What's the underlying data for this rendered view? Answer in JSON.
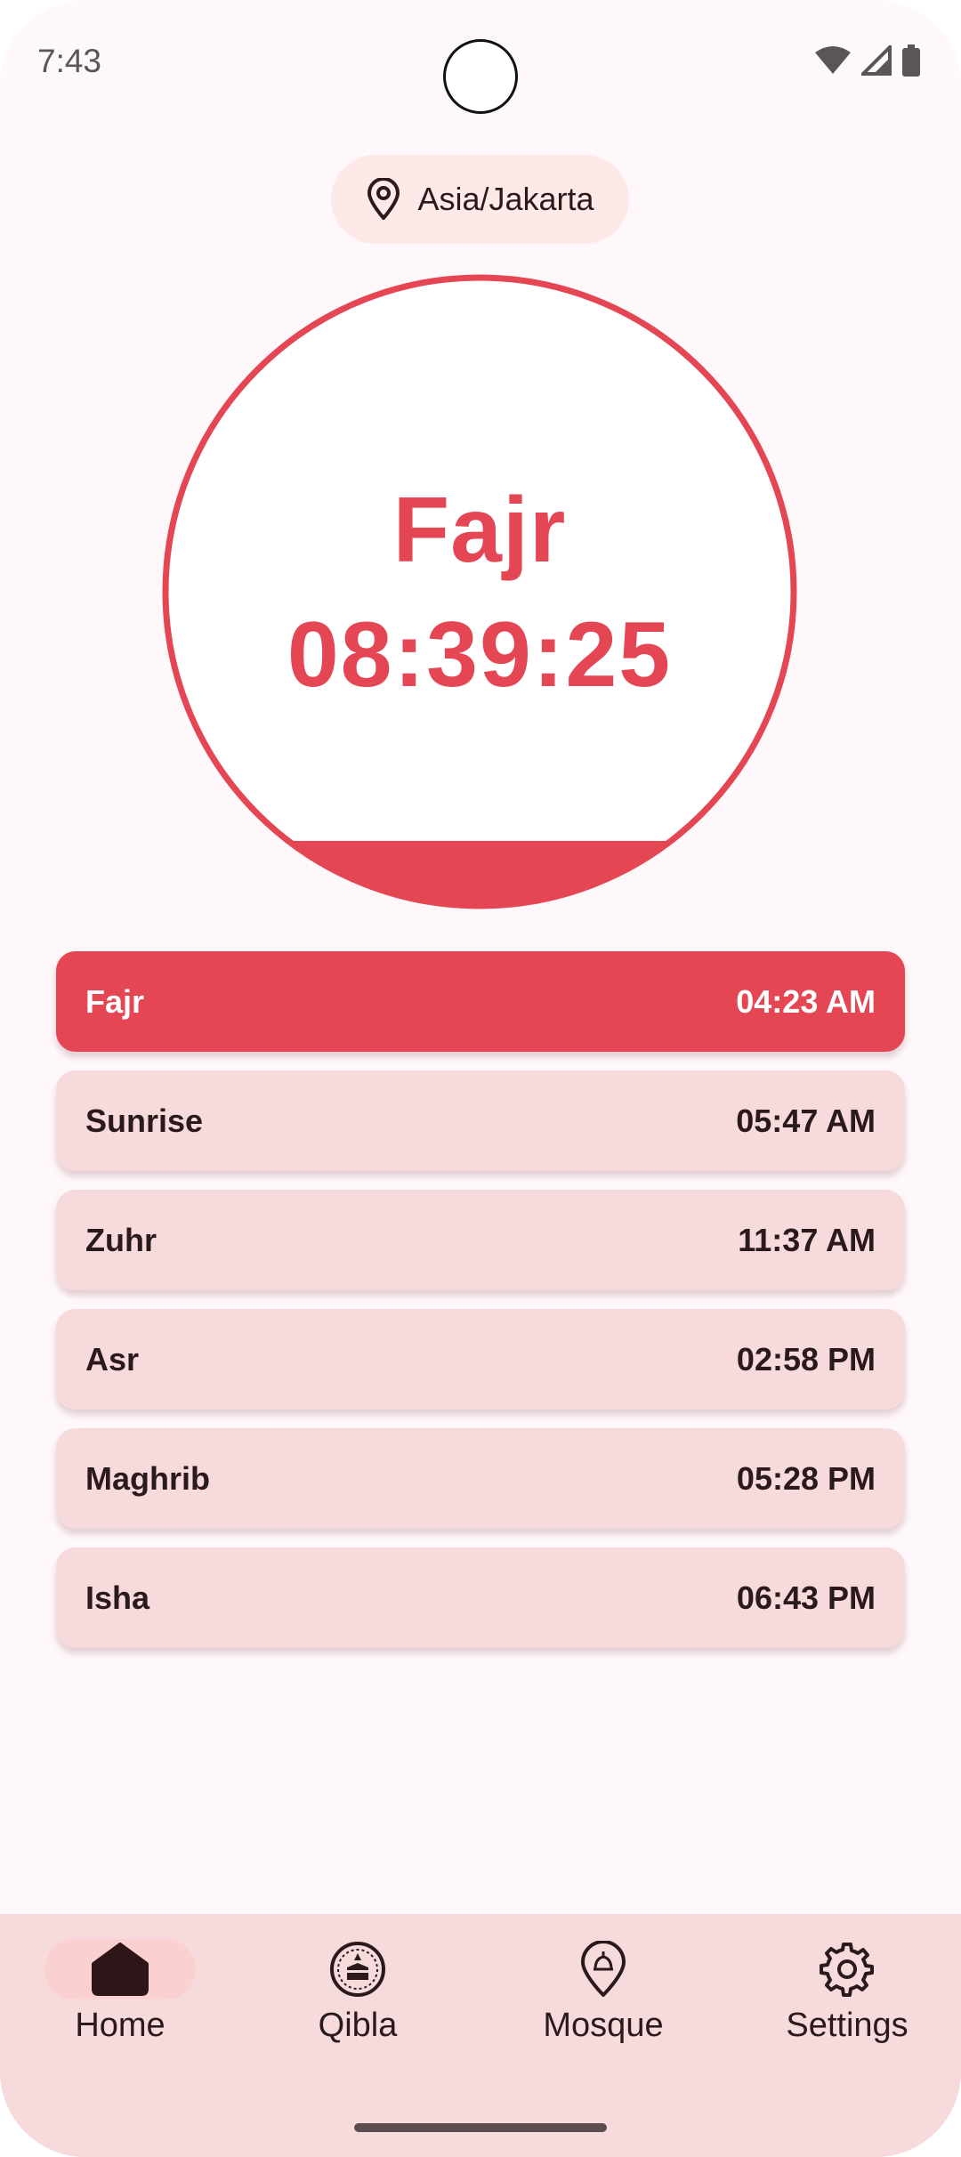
{
  "status_bar": {
    "time": "7:43",
    "icons": [
      "wifi-icon",
      "signal-icon",
      "battery-icon"
    ]
  },
  "location": {
    "icon": "location-pin-icon",
    "label": "Asia/Jakarta"
  },
  "countdown": {
    "prayer": "Fajr",
    "remaining": "08:39:25",
    "accent_color": "#e44653"
  },
  "prayers": [
    {
      "name": "Fajr",
      "time": "04:23 AM",
      "active": true
    },
    {
      "name": "Sunrise",
      "time": "05:47 AM",
      "active": false
    },
    {
      "name": "Zuhr",
      "time": "11:37 AM",
      "active": false
    },
    {
      "name": "Asr",
      "time": "02:58 PM",
      "active": false
    },
    {
      "name": "Maghrib",
      "time": "05:28 PM",
      "active": false
    },
    {
      "name": "Isha",
      "time": "06:43 PM",
      "active": false
    }
  ],
  "nav": [
    {
      "label": "Home",
      "icon": "home-icon",
      "active": true
    },
    {
      "label": "Qibla",
      "icon": "kaaba-compass-icon",
      "active": false
    },
    {
      "label": "Mosque",
      "icon": "mosque-pin-icon",
      "active": false
    },
    {
      "label": "Settings",
      "icon": "gear-icon",
      "active": false
    }
  ],
  "colors": {
    "accent": "#e44653",
    "card": "#f7dadc",
    "background": "#fff8fa"
  }
}
